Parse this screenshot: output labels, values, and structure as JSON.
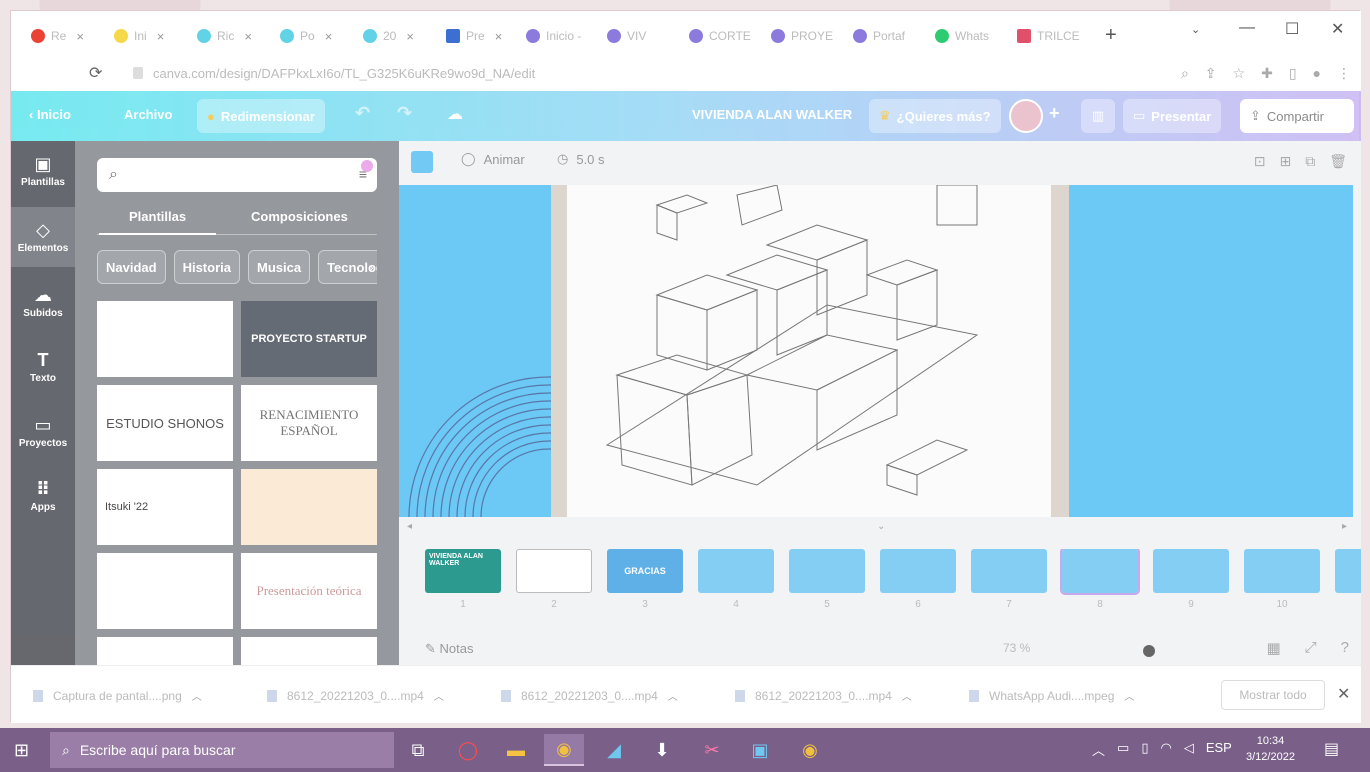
{
  "browser": {
    "tabs": [
      {
        "label": "Re",
        "color": "#ea4335"
      },
      {
        "label": "Ini",
        "color": "#f6d84b"
      },
      {
        "label": "Ric",
        "color": "#62d2e7"
      },
      {
        "label": "Po",
        "color": "#62d2e7"
      },
      {
        "label": "20",
        "color": "#62d2e7"
      },
      {
        "label": "Pre",
        "color": "#3c6fd1"
      },
      {
        "label": "Inicio -",
        "color": "#8c7bdc"
      },
      {
        "label": "VIV",
        "color": "#8c7bdc"
      },
      {
        "label": "CORTE",
        "color": "#8c7bdc"
      },
      {
        "label": "PROYE",
        "color": "#8c7bdc"
      },
      {
        "label": "Portaf",
        "color": "#8c7bdc"
      },
      {
        "label": "Whats",
        "color": "#2ecc71"
      },
      {
        "label": "TRILCE",
        "color": "#e0506b"
      }
    ],
    "new_tab": "+",
    "url": "canva.com/design/DAFPkxLxI6o/TL_G325K6uKRe9wo9d_NA/edit"
  },
  "canva": {
    "back": "Inicio",
    "file": "Archivo",
    "resize": "Redimensionar",
    "title": "VIVIENDA ALAN WALKER",
    "more": "¿Quieres más?",
    "present": "Presentar",
    "share": "Compartir"
  },
  "rail": [
    {
      "label": "Plantillas",
      "icon": "layout-icon"
    },
    {
      "label": "Elementos",
      "icon": "shapes-icon"
    },
    {
      "label": "Subidos",
      "icon": "cloud-upload-icon"
    },
    {
      "label": "Texto",
      "icon": "text-icon"
    },
    {
      "label": "Proyectos",
      "icon": "folder-icon"
    },
    {
      "label": "Apps",
      "icon": "apps-grid-icon"
    }
  ],
  "panel": {
    "search_placeholder": "",
    "tabs": [
      "Plantillas",
      "Composiciones"
    ],
    "chips": [
      "Navidad",
      "Historia",
      "Musica",
      "Tecnologia"
    ],
    "templates": [
      {
        "text": "",
        "bg": "#ffffff"
      },
      {
        "text": "PROYECTO STARTUP",
        "bg": "#555b66"
      },
      {
        "text": "ESTUDIO SHONOS",
        "bg": "#ffffff"
      },
      {
        "text": "RENACIMIENTO ESPAÑOL",
        "bg": "#ffffff"
      },
      {
        "text": "Itsuki '22",
        "bg": "#ffffff"
      },
      {
        "text": "",
        "bg": "#fbe8d2"
      },
      {
        "text": "",
        "bg": "#ffffff"
      },
      {
        "text": "Presentación teórica",
        "bg": "#ffffff"
      },
      {
        "text": "",
        "bg": "#ffffff"
      },
      {
        "text": "",
        "bg": "#ffffff"
      }
    ]
  },
  "editor": {
    "animate": "Animar",
    "duration": "5.0 s",
    "page_count": "10",
    "pages": [
      "1",
      "2",
      "3",
      "4",
      "5",
      "6",
      "7",
      "8",
      "9",
      "10"
    ],
    "thumb_labels": [
      "VIVIENDA ALAN WALKER",
      "",
      "GRACIAS",
      "",
      "",
      "",
      "",
      "",
      "",
      ""
    ],
    "notes": "Notas",
    "zoom": "73 %"
  },
  "downloads": [
    "Captura de pantal....png",
    "8612_20221203_0....mp4",
    "8612_20221203_0....mp4",
    "8612_20221203_0....mp4",
    "WhatsApp Audi....mpeg"
  ],
  "show_all": "Mostrar todo",
  "taskbar": {
    "search": "Escribe aquí para buscar",
    "lang": "ESP",
    "time": "10:34",
    "date": "3/12/2022"
  }
}
